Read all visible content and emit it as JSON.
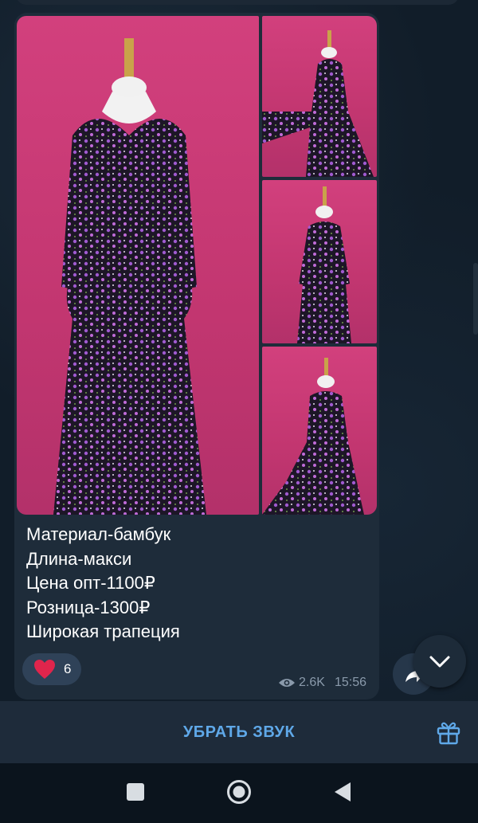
{
  "post": {
    "caption_lines": [
      "Материал-бамбук",
      "Длина-макси",
      "Цена опт-1100₽",
      "Розница-1300₽",
      "Широкая трапеция"
    ],
    "reaction": {
      "emoji": "heart-icon",
      "count": "6"
    },
    "views": "2.6K",
    "time": "15:56"
  },
  "bottom_bar": {
    "mute_label": "УБРАТЬ ЗВУК",
    "gift_icon": "gift-icon"
  },
  "colors": {
    "accent": "#5fa8e8",
    "bubble": "#1e2c3a",
    "photo_background": "#c9396f",
    "heart": "#e0254c"
  }
}
